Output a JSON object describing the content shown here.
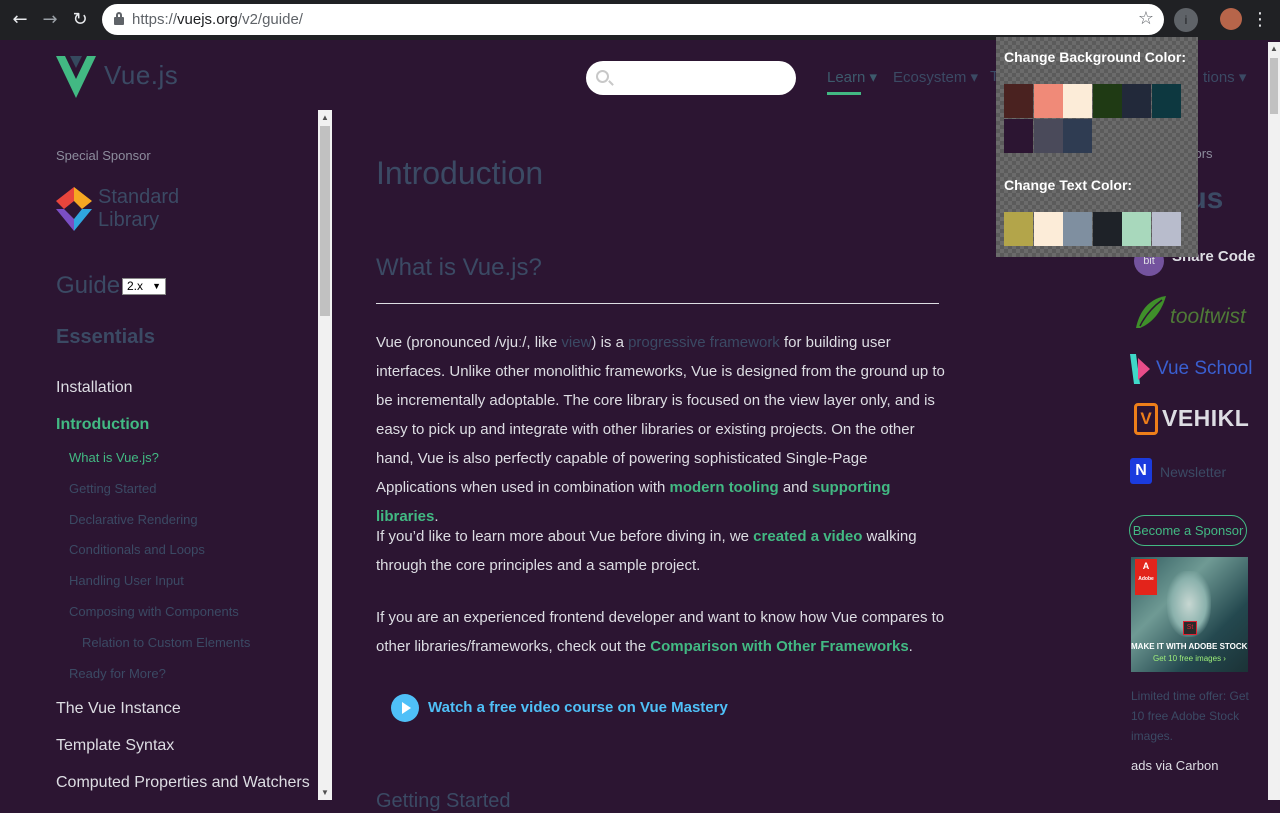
{
  "browser": {
    "url_scheme": "https://",
    "url_host": "vuejs.org",
    "url_path": "/v2/guide/"
  },
  "header": {
    "logo_text": "Vue.js",
    "search_placeholder": "",
    "nav": [
      "Learn",
      "Ecosystem",
      "T",
      "tions"
    ]
  },
  "sidebar": {
    "special_sponsor": "Special Sponsor",
    "stdlib_line1": "Standard",
    "stdlib_line2": "Library",
    "guide_title": "Guide",
    "version": "2.x",
    "essentials": "Essentials",
    "items": [
      {
        "label": "Installation",
        "level": 1
      },
      {
        "label": "Introduction",
        "level": 1
      },
      {
        "label": "What is Vue.js?",
        "level": 2
      },
      {
        "label": "Getting Started",
        "level": 2
      },
      {
        "label": "Declarative Rendering",
        "level": 2
      },
      {
        "label": "Conditionals and Loops",
        "level": 2
      },
      {
        "label": "Handling User Input",
        "level": 2
      },
      {
        "label": "Composing with Components",
        "level": 2
      },
      {
        "label": "Relation to Custom Elements",
        "level": 3
      },
      {
        "label": "Ready for More?",
        "level": 2
      },
      {
        "label": "The Vue Instance",
        "level": 1
      },
      {
        "label": "Template Syntax",
        "level": 1
      },
      {
        "label": "Computed Properties and Watchers",
        "level": 1
      }
    ]
  },
  "content": {
    "title": "Introduction",
    "h2": "What is Vue.js?",
    "p1_a": "Vue (pronounced /vjuː/, like ",
    "p1_view": "view",
    "p1_b": ") is a ",
    "p1_prog": "progressive framework",
    "p1_c": " for building user interfaces. Unlike other monolithic frameworks, Vue is designed from the ground up to be incrementally adoptable. The core library is focused on the view layer only, and is easy to pick up and integrate with other libraries or existing projects. On the other hand, Vue is also perfectly capable of powering sophisticated Single-Page Applications when used in combination with ",
    "p1_tooling": "modern tooling",
    "p1_d": " and ",
    "p1_libs": "supporting libraries",
    "p1_e": ".",
    "p2_a": "If you’d like to learn more about Vue before diving in, we ",
    "p2_link": "created a video",
    "p2_b": " walking through the core principles and a sample project.",
    "p3_a": "If you are an experienced frontend developer and want to know how Vue compares to other libraries/frameworks, check out the ",
    "p3_link": "Comparison with Other Frameworks",
    "p3_b": ".",
    "video_link": "Watch a free video course on Vue Mastery",
    "next_heading": "Getting Started"
  },
  "sponsors": {
    "label": "sors",
    "big": "ous",
    "bit": "bit",
    "share": "Share Code",
    "tooltwist": "tooltwist",
    "vueschool": "Vue School",
    "vehikl_mark": "V",
    "vehikl": "VEHIKL",
    "n_mark": "N",
    "n_text": "Newsletter",
    "become": "Become a Sponsor",
    "ad_mark": "Adobe",
    "ad_st": "St",
    "ad_line1": "MAKE IT WITH ADOBE STOCK.",
    "ad_line2": "Get 10 free images ›",
    "ad_desc": "Limited time offer: Get 10 free Adobe Stock images.",
    "ads_via": "ads via Carbon"
  },
  "popup": {
    "bg_title": "Change Background Color:",
    "text_title": "Change Text Color:",
    "bg_colors": [
      "#4a2220",
      "#f08a78",
      "#fcecd8",
      "#1f3a14",
      "#22293a",
      "#0d3840",
      "#2c1532",
      "#4a4a5a",
      "#2f3c52"
    ],
    "text_colors": [
      "#b3a54a",
      "#fcecd8",
      "#7f8fa0",
      "#1e2228",
      "#a8d8bc",
      "#b8bccc"
    ]
  }
}
